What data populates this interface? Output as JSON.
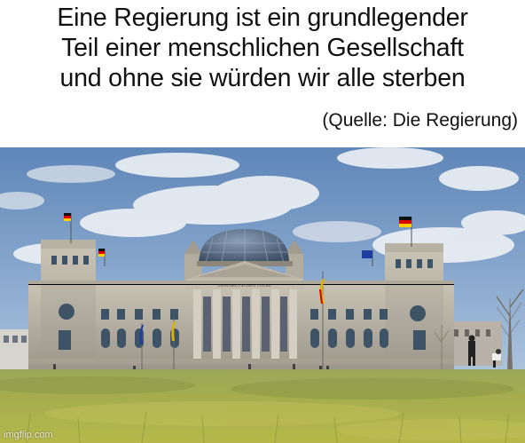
{
  "caption": {
    "lines": [
      "Eine Regierung ist ein grundlegender",
      "Teil einer menschlichen Gesellschaft",
      "und ohne sie würden wir alle sterben"
    ],
    "source": "(Quelle: Die Regierung)"
  },
  "photo": {
    "inscription": "DEM DEUTSCHEN VOLKE"
  },
  "watermark": "imgflip.com"
}
